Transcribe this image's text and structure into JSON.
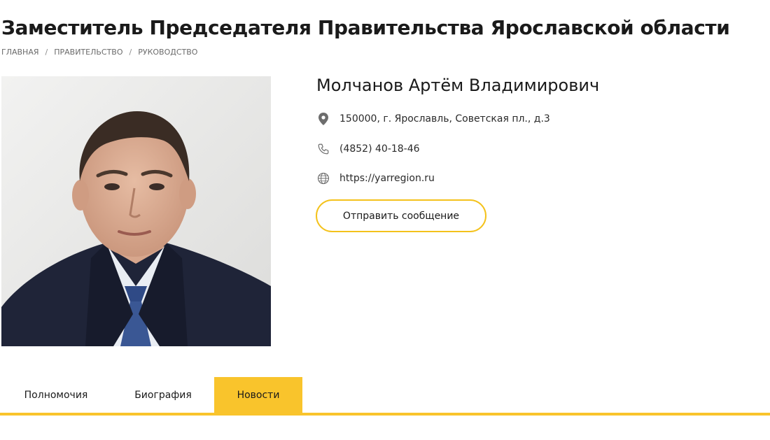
{
  "page": {
    "title": "Заместитель Председателя Правительства Ярославской области"
  },
  "breadcrumb": {
    "items": [
      "ГЛАВНАЯ",
      "ПРАВИТЕЛЬСТВО",
      "РУКОВОДСТВО"
    ],
    "separator": "/"
  },
  "person": {
    "name": "Молчанов Артём Владимирович",
    "address": "150000, г. Ярославль, Советская пл., д.3",
    "phone": "(4852) 40-18-46",
    "website": "https://yarregion.ru",
    "send_message_label": "Отправить сообщение"
  },
  "icons": {
    "address": "map-pin-icon",
    "phone": "phone-icon",
    "website": "globe-icon"
  },
  "tabs": [
    {
      "label": "Полномочия",
      "active": false
    },
    {
      "label": "Биография",
      "active": false
    },
    {
      "label": "Новости",
      "active": true
    }
  ],
  "colors": {
    "accent": "#f9c42c",
    "button_border": "#f4c21b",
    "text": "#1a1a1a",
    "muted": "#6b6b6b"
  }
}
